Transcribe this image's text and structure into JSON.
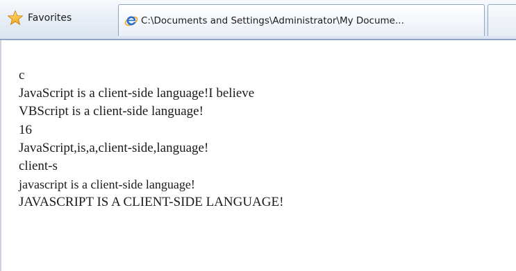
{
  "toolbar": {
    "favorites_label": "Favorites"
  },
  "tabs": [
    {
      "title": "C:\\Documents and Settings\\Administrator\\My Docume...",
      "active": true
    }
  ],
  "page": {
    "lines": [
      "c",
      "JavaScript is a client-side language!I believe",
      "VBScript is a client-side language!",
      "16",
      "JavaScript,is,a,client-side,language!",
      "client-s",
      "javascript is a client-side language!",
      "JAVASCRIPT IS A CLIENT-SIDE LANGUAGE!"
    ]
  },
  "colors": {
    "toolbar_bg": "#e6edf6",
    "tab_border": "#8ea6c6",
    "text": "#1a1a1a"
  },
  "icons": {
    "favorites": "star-icon",
    "page": "ie-logo-icon"
  }
}
